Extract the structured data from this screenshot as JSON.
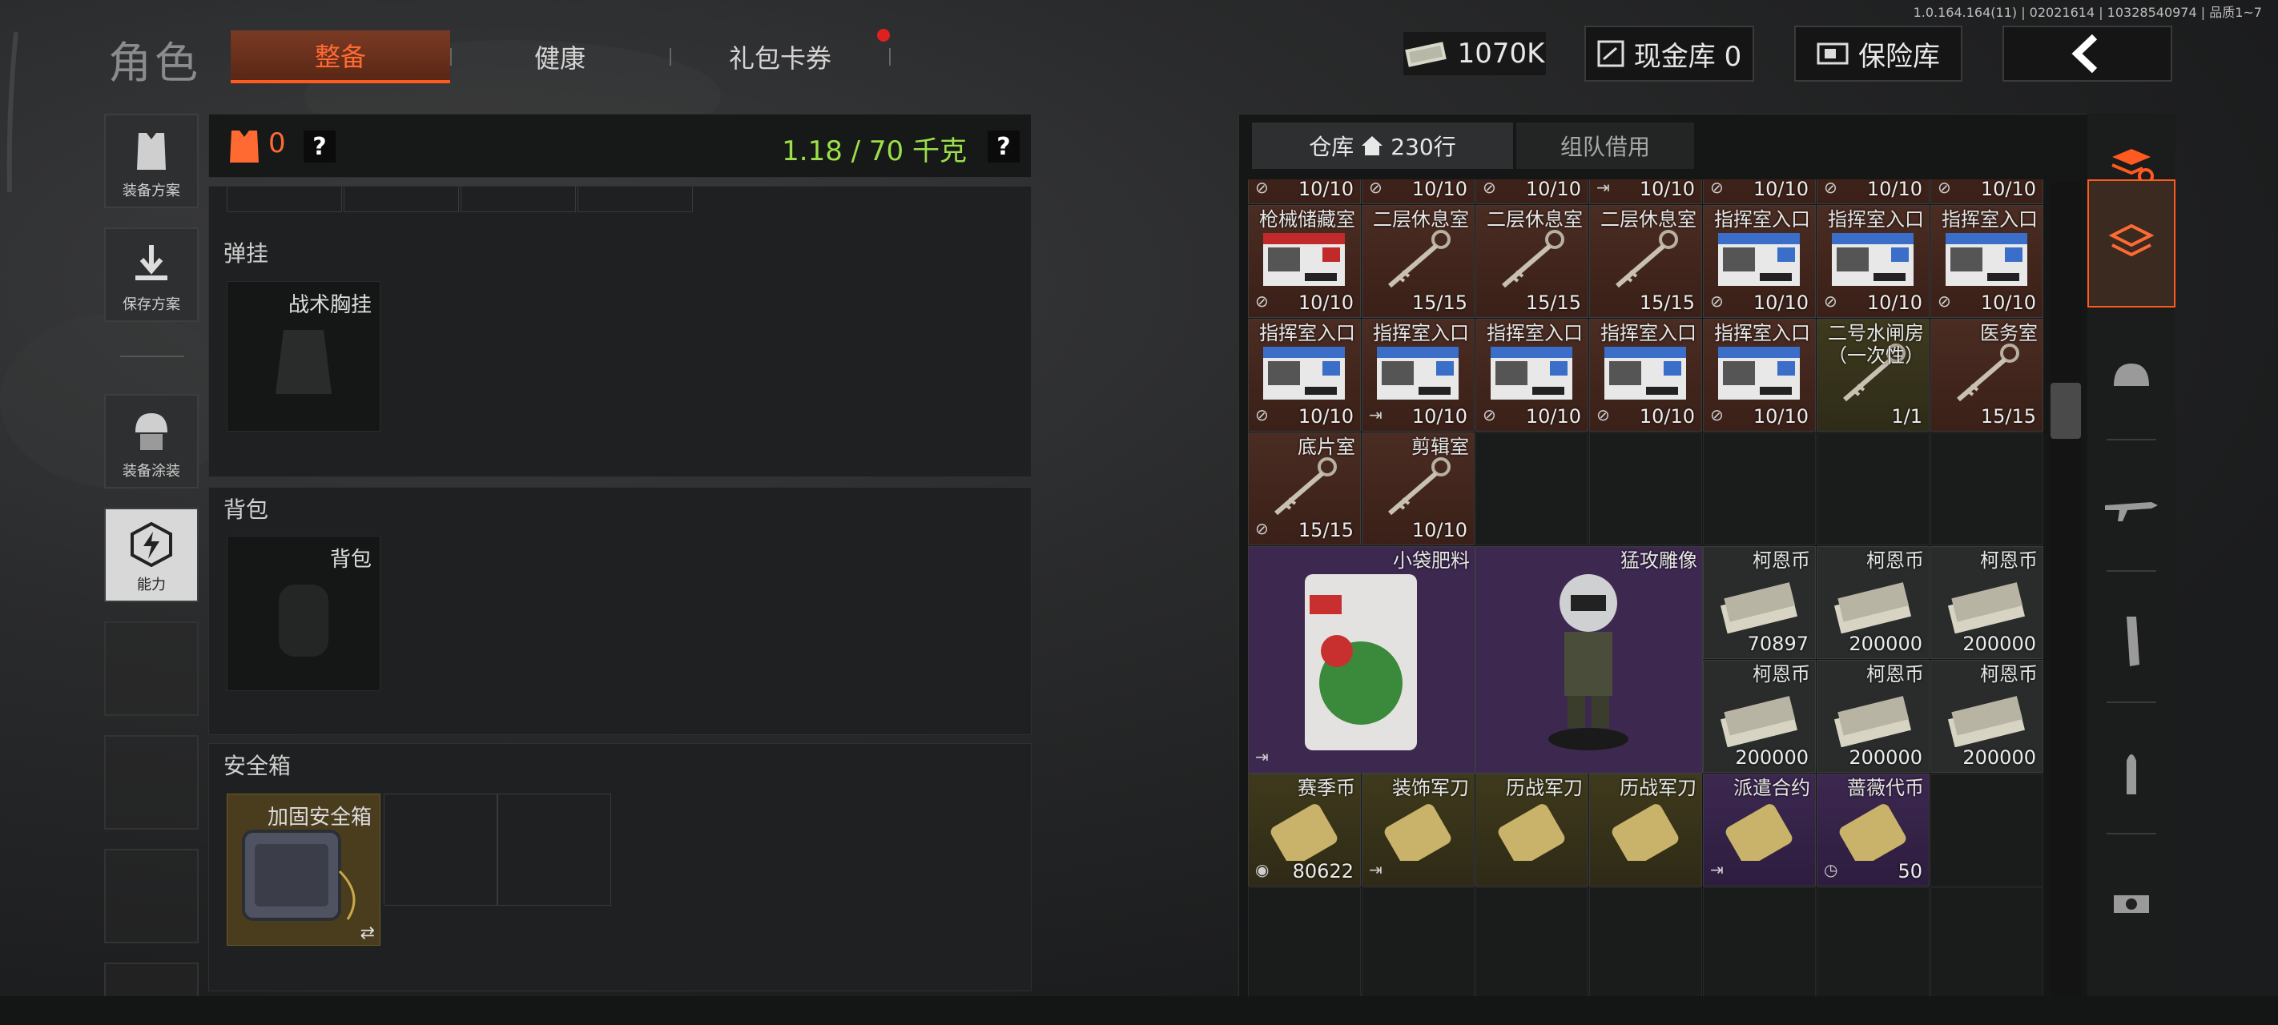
{
  "version": "1.0.164.164(11) | 02021614 | 10328540974 | 品质1~7",
  "title": "角色",
  "tabs": [
    {
      "label": "整备",
      "active": true
    },
    {
      "label": "健康"
    },
    {
      "label": "礼包卡券",
      "badge": true
    }
  ],
  "money": "1070K",
  "cash_vault": "现金库 0",
  "insurance": "保险库",
  "sidebar": [
    "装备方案",
    "保存方案",
    "装备涂装",
    "能力"
  ],
  "loadout": {
    "armor_count": "0",
    "weight": "1.18 / 70 千克",
    "sections": [
      {
        "header": "弹挂",
        "slot_label": "战术胸挂"
      },
      {
        "header": "背包",
        "slot_label": "背包"
      },
      {
        "header": "安全箱",
        "slot_label": "加固安全箱"
      }
    ]
  },
  "warehouse": {
    "tab_storage": "仓库",
    "rows": "230行",
    "tab_team": "组队借用",
    "items": [
      {
        "name": "",
        "count": "10/10",
        "color": "brown",
        "flag": "no"
      },
      {
        "name": "",
        "count": "10/10",
        "color": "brown",
        "flag": "no"
      },
      {
        "name": "",
        "count": "10/10",
        "color": "brown",
        "flag": "no"
      },
      {
        "name": "",
        "count": "10/10",
        "color": "brown",
        "flag": "out"
      },
      {
        "name": "",
        "count": "10/10",
        "color": "brown",
        "flag": "no"
      },
      {
        "name": "",
        "count": "10/10",
        "color": "brown",
        "flag": "no"
      },
      {
        "name": "",
        "count": "10/10",
        "color": "brown",
        "flag": "no"
      },
      {
        "name": "枪械储藏室",
        "count": "10/10",
        "color": "brown",
        "flag": "no",
        "art": "card-red"
      },
      {
        "name": "二层休息室",
        "count": "15/15",
        "color": "brown",
        "flag": "",
        "art": "key"
      },
      {
        "name": "二层休息室",
        "count": "15/15",
        "color": "brown",
        "flag": "",
        "art": "key"
      },
      {
        "name": "二层休息室",
        "count": "15/15",
        "color": "brown",
        "flag": "",
        "art": "key"
      },
      {
        "name": "指挥室入口",
        "count": "10/10",
        "color": "brown",
        "flag": "no",
        "art": "card"
      },
      {
        "name": "指挥室入口",
        "count": "10/10",
        "color": "brown",
        "flag": "no",
        "art": "card"
      },
      {
        "name": "指挥室入口",
        "count": "10/10",
        "color": "brown",
        "flag": "no",
        "art": "card"
      },
      {
        "name": "指挥室入口",
        "count": "10/10",
        "color": "brown",
        "flag": "no",
        "art": "card"
      },
      {
        "name": "指挥室入口",
        "count": "10/10",
        "color": "brown",
        "flag": "out",
        "art": "card"
      },
      {
        "name": "指挥室入口",
        "count": "10/10",
        "color": "brown",
        "flag": "no",
        "art": "card"
      },
      {
        "name": "指挥室入口",
        "count": "10/10",
        "color": "brown",
        "flag": "no",
        "art": "card"
      },
      {
        "name": "指挥室入口",
        "count": "10/10",
        "color": "brown",
        "flag": "no",
        "art": "card"
      },
      {
        "name": "二号水闸房\n（一次性）",
        "count": "1/1",
        "color": "olive",
        "flag": "",
        "art": "key"
      },
      {
        "name": "医务室",
        "count": "15/15",
        "color": "brown",
        "flag": "",
        "art": "key"
      },
      {
        "name": "底片室",
        "count": "15/15",
        "color": "brown",
        "flag": "no",
        "art": "key"
      },
      {
        "name": "剪辑室",
        "count": "10/10",
        "color": "brown",
        "flag": "",
        "art": "key"
      }
    ],
    "fertilizer": {
      "name": "小袋肥料"
    },
    "statue": {
      "name": "猛攻雕像"
    },
    "coins": [
      {
        "name": "柯恩币",
        "count": "70897"
      },
      {
        "name": "柯恩币",
        "count": "200000"
      },
      {
        "name": "柯恩币",
        "count": "200000"
      },
      {
        "name": "柯恩币",
        "count": "200000"
      },
      {
        "name": "柯恩币",
        "count": "200000"
      },
      {
        "name": "柯恩币",
        "count": "200000"
      }
    ],
    "bottom": [
      {
        "name": "赛季币",
        "count": "80622",
        "color": "gold",
        "flag": "coin"
      },
      {
        "name": "装饰军刀",
        "count": "",
        "color": "gold",
        "flag": "out"
      },
      {
        "name": "历战军刀",
        "count": "",
        "color": "gold",
        "flag": ""
      },
      {
        "name": "历战军刀",
        "count": "",
        "color": "gold",
        "flag": ""
      },
      {
        "name": "派遣合约",
        "count": "",
        "color": "purple",
        "flag": "out"
      },
      {
        "name": "蔷薇代币",
        "count": "50",
        "color": "purple",
        "flag": "clock"
      }
    ]
  },
  "colors": {
    "accent": "#ff5a1f",
    "weight": "#9be04a",
    "brown": "#4a2c22",
    "purple": "#3d2850",
    "gold": "#3f3a1c"
  }
}
